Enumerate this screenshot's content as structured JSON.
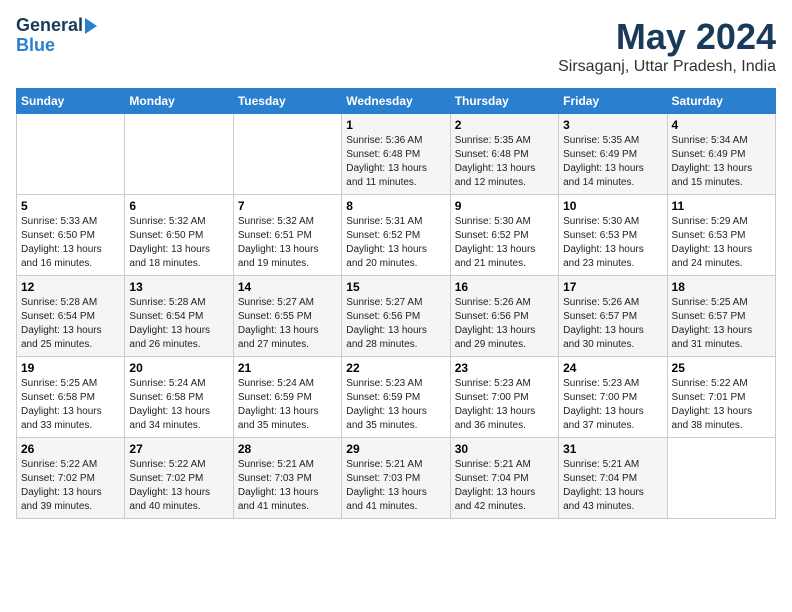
{
  "header": {
    "logo_general": "General",
    "logo_blue": "Blue",
    "title": "May 2024",
    "location": "Sirsaganj, Uttar Pradesh, India"
  },
  "calendar": {
    "columns": [
      "Sunday",
      "Monday",
      "Tuesday",
      "Wednesday",
      "Thursday",
      "Friday",
      "Saturday"
    ],
    "weeks": [
      [
        {
          "day": "",
          "info": ""
        },
        {
          "day": "",
          "info": ""
        },
        {
          "day": "",
          "info": ""
        },
        {
          "day": "1",
          "info": "Sunrise: 5:36 AM\nSunset: 6:48 PM\nDaylight: 13 hours\nand 11 minutes."
        },
        {
          "day": "2",
          "info": "Sunrise: 5:35 AM\nSunset: 6:48 PM\nDaylight: 13 hours\nand 12 minutes."
        },
        {
          "day": "3",
          "info": "Sunrise: 5:35 AM\nSunset: 6:49 PM\nDaylight: 13 hours\nand 14 minutes."
        },
        {
          "day": "4",
          "info": "Sunrise: 5:34 AM\nSunset: 6:49 PM\nDaylight: 13 hours\nand 15 minutes."
        }
      ],
      [
        {
          "day": "5",
          "info": "Sunrise: 5:33 AM\nSunset: 6:50 PM\nDaylight: 13 hours\nand 16 minutes."
        },
        {
          "day": "6",
          "info": "Sunrise: 5:32 AM\nSunset: 6:50 PM\nDaylight: 13 hours\nand 18 minutes."
        },
        {
          "day": "7",
          "info": "Sunrise: 5:32 AM\nSunset: 6:51 PM\nDaylight: 13 hours\nand 19 minutes."
        },
        {
          "day": "8",
          "info": "Sunrise: 5:31 AM\nSunset: 6:52 PM\nDaylight: 13 hours\nand 20 minutes."
        },
        {
          "day": "9",
          "info": "Sunrise: 5:30 AM\nSunset: 6:52 PM\nDaylight: 13 hours\nand 21 minutes."
        },
        {
          "day": "10",
          "info": "Sunrise: 5:30 AM\nSunset: 6:53 PM\nDaylight: 13 hours\nand 23 minutes."
        },
        {
          "day": "11",
          "info": "Sunrise: 5:29 AM\nSunset: 6:53 PM\nDaylight: 13 hours\nand 24 minutes."
        }
      ],
      [
        {
          "day": "12",
          "info": "Sunrise: 5:28 AM\nSunset: 6:54 PM\nDaylight: 13 hours\nand 25 minutes."
        },
        {
          "day": "13",
          "info": "Sunrise: 5:28 AM\nSunset: 6:54 PM\nDaylight: 13 hours\nand 26 minutes."
        },
        {
          "day": "14",
          "info": "Sunrise: 5:27 AM\nSunset: 6:55 PM\nDaylight: 13 hours\nand 27 minutes."
        },
        {
          "day": "15",
          "info": "Sunrise: 5:27 AM\nSunset: 6:56 PM\nDaylight: 13 hours\nand 28 minutes."
        },
        {
          "day": "16",
          "info": "Sunrise: 5:26 AM\nSunset: 6:56 PM\nDaylight: 13 hours\nand 29 minutes."
        },
        {
          "day": "17",
          "info": "Sunrise: 5:26 AM\nSunset: 6:57 PM\nDaylight: 13 hours\nand 30 minutes."
        },
        {
          "day": "18",
          "info": "Sunrise: 5:25 AM\nSunset: 6:57 PM\nDaylight: 13 hours\nand 31 minutes."
        }
      ],
      [
        {
          "day": "19",
          "info": "Sunrise: 5:25 AM\nSunset: 6:58 PM\nDaylight: 13 hours\nand 33 minutes."
        },
        {
          "day": "20",
          "info": "Sunrise: 5:24 AM\nSunset: 6:58 PM\nDaylight: 13 hours\nand 34 minutes."
        },
        {
          "day": "21",
          "info": "Sunrise: 5:24 AM\nSunset: 6:59 PM\nDaylight: 13 hours\nand 35 minutes."
        },
        {
          "day": "22",
          "info": "Sunrise: 5:23 AM\nSunset: 6:59 PM\nDaylight: 13 hours\nand 35 minutes."
        },
        {
          "day": "23",
          "info": "Sunrise: 5:23 AM\nSunset: 7:00 PM\nDaylight: 13 hours\nand 36 minutes."
        },
        {
          "day": "24",
          "info": "Sunrise: 5:23 AM\nSunset: 7:00 PM\nDaylight: 13 hours\nand 37 minutes."
        },
        {
          "day": "25",
          "info": "Sunrise: 5:22 AM\nSunset: 7:01 PM\nDaylight: 13 hours\nand 38 minutes."
        }
      ],
      [
        {
          "day": "26",
          "info": "Sunrise: 5:22 AM\nSunset: 7:02 PM\nDaylight: 13 hours\nand 39 minutes."
        },
        {
          "day": "27",
          "info": "Sunrise: 5:22 AM\nSunset: 7:02 PM\nDaylight: 13 hours\nand 40 minutes."
        },
        {
          "day": "28",
          "info": "Sunrise: 5:21 AM\nSunset: 7:03 PM\nDaylight: 13 hours\nand 41 minutes."
        },
        {
          "day": "29",
          "info": "Sunrise: 5:21 AM\nSunset: 7:03 PM\nDaylight: 13 hours\nand 41 minutes."
        },
        {
          "day": "30",
          "info": "Sunrise: 5:21 AM\nSunset: 7:04 PM\nDaylight: 13 hours\nand 42 minutes."
        },
        {
          "day": "31",
          "info": "Sunrise: 5:21 AM\nSunset: 7:04 PM\nDaylight: 13 hours\nand 43 minutes."
        },
        {
          "day": "",
          "info": ""
        }
      ]
    ]
  }
}
